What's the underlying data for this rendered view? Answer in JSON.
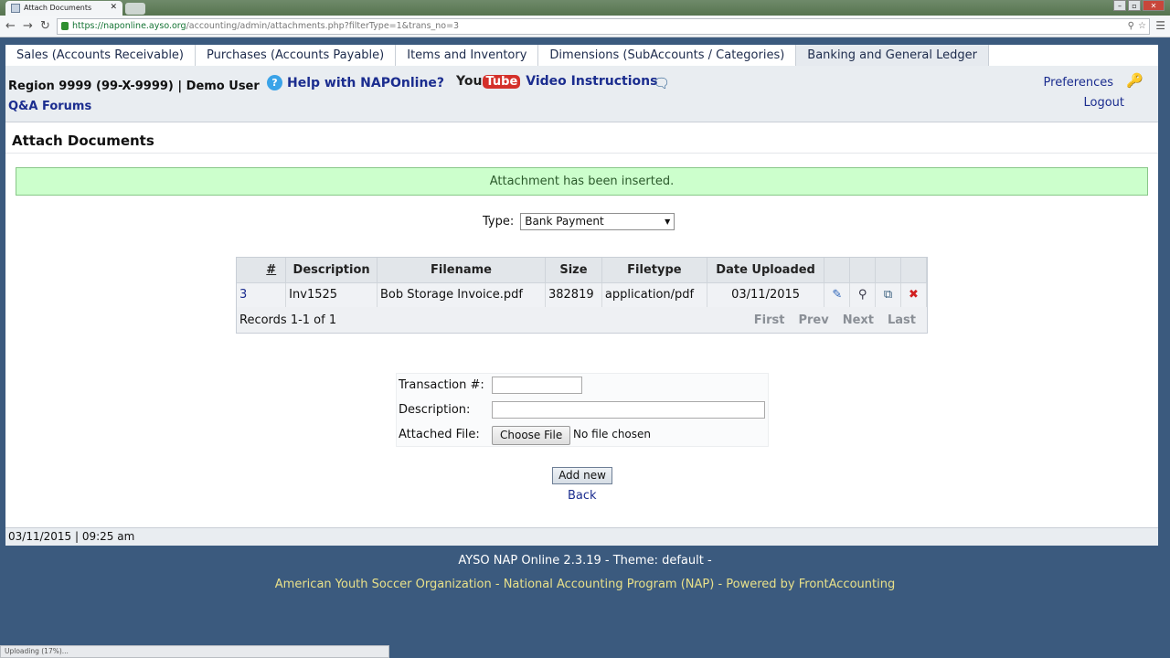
{
  "browser": {
    "tab_title": "Attach Documents",
    "url_scheme": "https://",
    "url_host": "naponline.ayso.org",
    "url_path": "/accounting/admin/attachments.php?filterType=1&trans_no=3",
    "status_text": "Uploading (17%)..."
  },
  "nav": {
    "items": [
      {
        "label": "Sales (Accounts Receivable)"
      },
      {
        "label": "Purchases (Accounts Payable)"
      },
      {
        "label": "Items and Inventory"
      },
      {
        "label": "Dimensions (SubAccounts / Categories)"
      },
      {
        "label": "Banking and General Ledger"
      }
    ]
  },
  "header": {
    "region": "Region 9999 (99-X-9999) | Demo User",
    "qa_forums": "Q&A Forums",
    "help_link": "Help with NAPOnline?",
    "youtube_you": "You",
    "youtube_tube": "Tube",
    "video_link": "Video Instructions",
    "preferences": "Preferences",
    "logout": "Logout"
  },
  "page": {
    "title": "Attach Documents",
    "message": "Attachment has been inserted.",
    "type_label": "Type:",
    "type_value": "Bank Payment"
  },
  "table": {
    "headers": [
      "#",
      "Description",
      "Filename",
      "Size",
      "Filetype",
      "Date Uploaded"
    ],
    "rows": [
      {
        "num": "3",
        "description": "Inv1525",
        "filename": "Bob Storage Invoice.pdf",
        "size": "382819",
        "filetype": "application/pdf",
        "date": "03/11/2015"
      }
    ],
    "records": "Records 1-1 of 1",
    "pager": {
      "first": "First",
      "prev": "Prev",
      "next": "Next",
      "last": "Last"
    }
  },
  "form": {
    "trans_label": "Transaction #:",
    "trans_value": "",
    "desc_label": "Description:",
    "desc_value": "",
    "file_label": "Attached File:",
    "file_button": "Choose File",
    "file_status": "No file chosen",
    "add_button": "Add new",
    "back_link": "Back"
  },
  "status": {
    "datetime": "03/11/2015 | 09:25 am"
  },
  "footer": {
    "version": "AYSO NAP Online 2.3.19 - Theme: default -",
    "org": "American Youth Soccer Organization - National Accounting Program (NAP) - Powered by FrontAccounting"
  },
  "colors": {
    "page_bg": "#3b5a7e",
    "link": "#1b2d8f",
    "success_bg": "#ccffcc",
    "footer_org": "#e8e08a"
  },
  "icons": [
    "pencil-icon",
    "magnifier-icon",
    "copy-icon",
    "delete-icon",
    "help-icon",
    "chat-icon",
    "key-icon"
  ]
}
